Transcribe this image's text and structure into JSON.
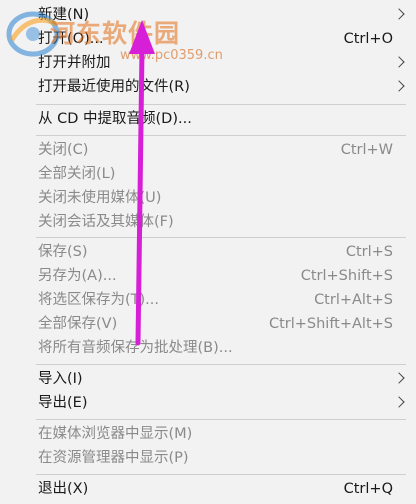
{
  "menu": {
    "items": [
      {
        "label": "新建(N)",
        "shortcut": "",
        "arrow": true
      },
      {
        "label": "打开(O)...",
        "shortcut": "Ctrl+O",
        "arrow": false
      },
      {
        "label": "打开并附加",
        "shortcut": "",
        "arrow": true
      },
      {
        "label": "打开最近使用的文件(R)",
        "shortcut": "",
        "arrow": true
      },
      {
        "label": "从 CD 中提取音频(D)...",
        "shortcut": "",
        "arrow": false
      },
      {
        "label": "关闭(C)",
        "shortcut": "Ctrl+W",
        "arrow": false
      },
      {
        "label": "全部关闭(L)",
        "shortcut": "",
        "arrow": false
      },
      {
        "label": "关闭未使用媒体(U)",
        "shortcut": "",
        "arrow": false
      },
      {
        "label": "关闭会话及其媒体(F)",
        "shortcut": "",
        "arrow": false
      },
      {
        "label": "保存(S)",
        "shortcut": "Ctrl+S",
        "arrow": false
      },
      {
        "label": "另存为(A)...",
        "shortcut": "Ctrl+Shift+S",
        "arrow": false
      },
      {
        "label": "将选区保存为(T)...",
        "shortcut": "Ctrl+Alt+S",
        "arrow": false
      },
      {
        "label": "全部保存(V)",
        "shortcut": "Ctrl+Shift+Alt+S",
        "arrow": false
      },
      {
        "label": "将所有音频保存为批处理(B)...",
        "shortcut": "",
        "arrow": false
      },
      {
        "label": "导入(I)",
        "shortcut": "",
        "arrow": true
      },
      {
        "label": "导出(E)",
        "shortcut": "",
        "arrow": true
      },
      {
        "label": "在媒体浏览器中显示(M)",
        "shortcut": "",
        "arrow": false
      },
      {
        "label": "在资源管理器中显示(P)",
        "shortcut": "",
        "arrow": false
      },
      {
        "label": "退出(X)",
        "shortcut": "Ctrl+Q",
        "arrow": false
      }
    ]
  },
  "watermark": {
    "title": "河东软件园",
    "url": "www.pc0359.cn"
  },
  "colors": {
    "menu_bg": "#f2f2f2",
    "text_enabled": "#1a1a1a",
    "text_disabled": "#8a8a8a",
    "annotation_arrow": "#d61fd6"
  }
}
